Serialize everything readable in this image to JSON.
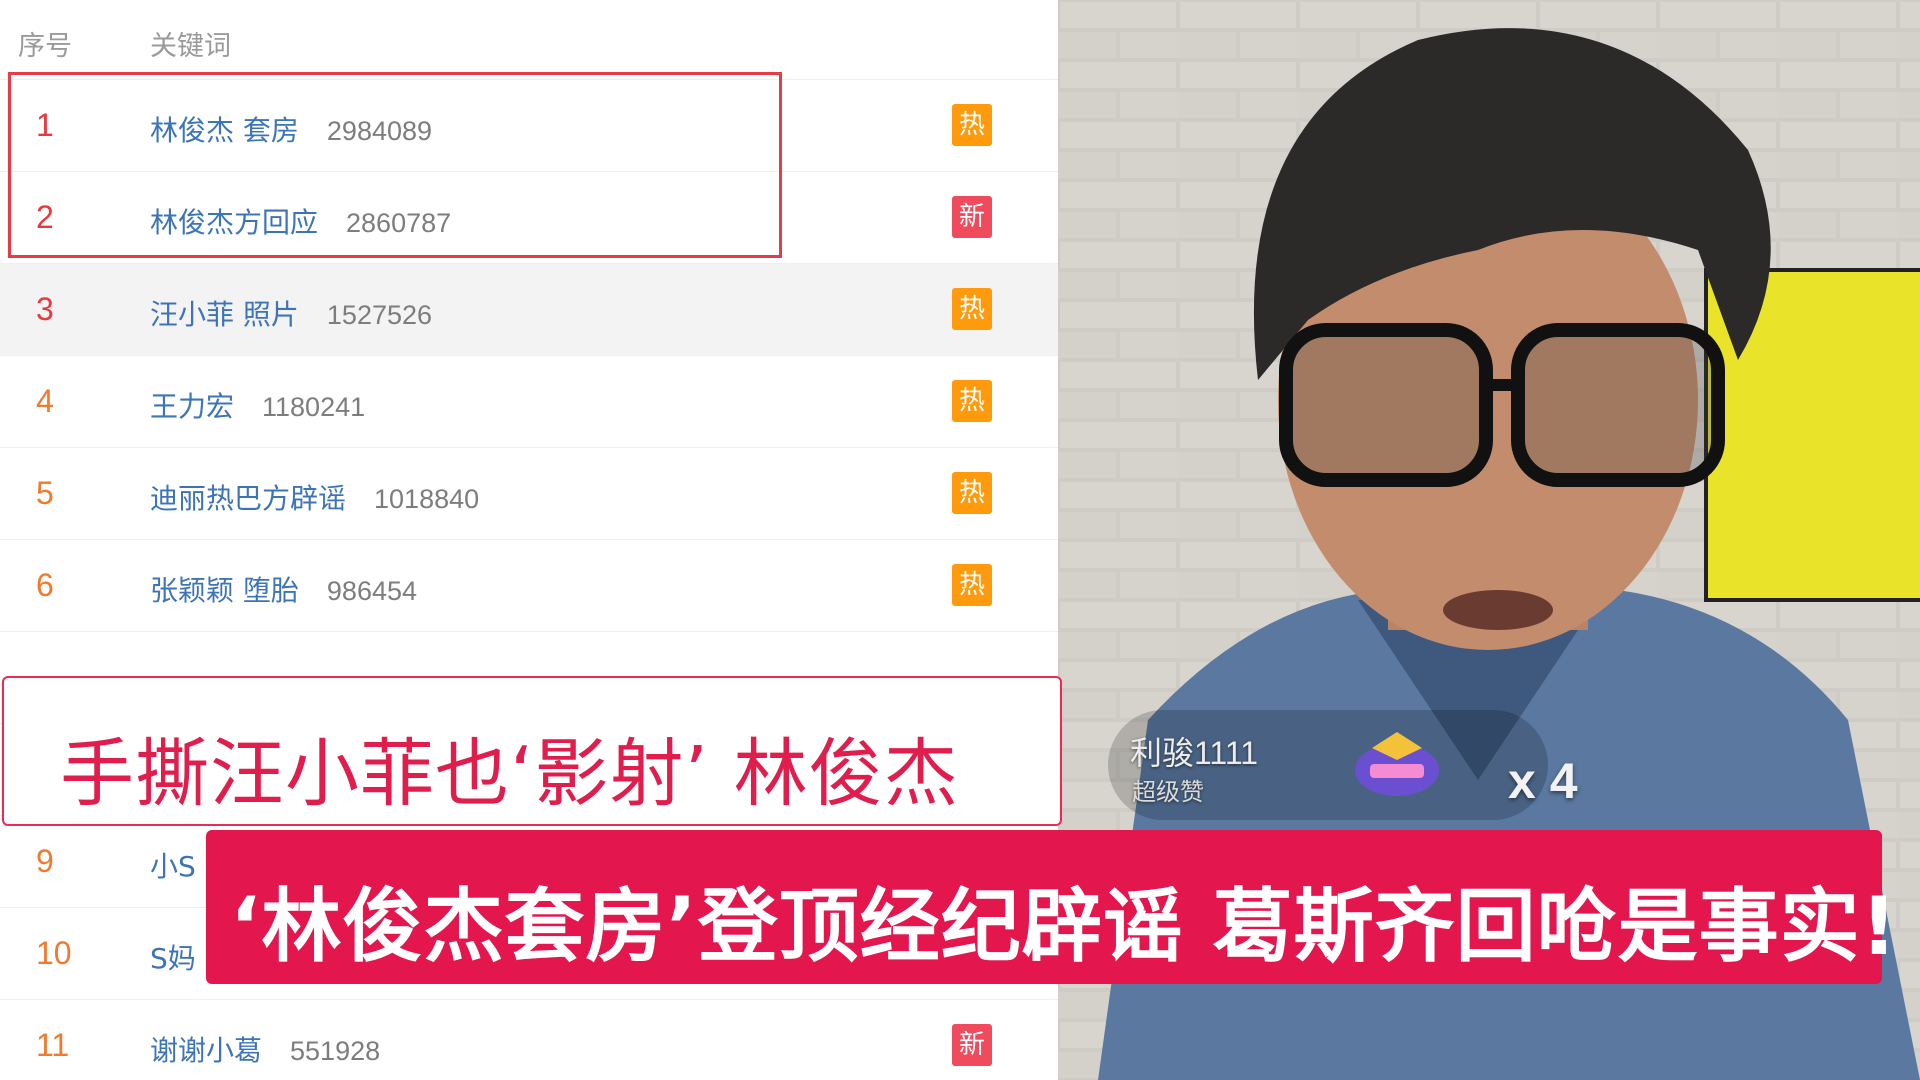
{
  "list": {
    "headers": {
      "rank": "序号",
      "keyword": "关键词"
    },
    "rows": [
      {
        "rank": "1",
        "keyword": "林俊杰 套房",
        "count": "2984089",
        "badge": "热",
        "badge_type": "hot"
      },
      {
        "rank": "2",
        "keyword": "林俊杰方回应",
        "count": "2860787",
        "badge": "新",
        "badge_type": "new"
      },
      {
        "rank": "3",
        "keyword": "汪小菲 照片",
        "count": "1527526",
        "badge": "热",
        "badge_type": "hot"
      },
      {
        "rank": "4",
        "keyword": "王力宏",
        "count": "1180241",
        "badge": "热",
        "badge_type": "hot"
      },
      {
        "rank": "5",
        "keyword": "迪丽热巴方辟谣",
        "count": "1018840",
        "badge": "热",
        "badge_type": "hot"
      },
      {
        "rank": "6",
        "keyword": "张颖颖 堕胎",
        "count": "986454",
        "badge": "热",
        "badge_type": "hot"
      },
      {
        "rank": "9",
        "keyword": "小S",
        "count": "",
        "badge": "",
        "badge_type": ""
      },
      {
        "rank": "10",
        "keyword": "S妈",
        "count": "",
        "badge": "",
        "badge_type": ""
      },
      {
        "rank": "11",
        "keyword": "谢谢小葛",
        "count": "551928",
        "badge": "新",
        "badge_type": "new"
      }
    ]
  },
  "stream": {
    "username": "利骏1111",
    "user_tag": "超级赞",
    "gift_count": "x 4"
  },
  "captions": {
    "line1": "手撕汪小菲也‘影射’ 林俊杰",
    "line2": "‘林俊杰套房’登顶经纪辟谣  葛斯齐回呛是事实!"
  },
  "colors": {
    "rank_top": "#e8393c",
    "rank": "#f07a2d",
    "keyword": "#3d74b8",
    "badge_hot": "#ff9a0c",
    "badge_new": "#f04a5d",
    "caption_accent": "#e3164e"
  }
}
